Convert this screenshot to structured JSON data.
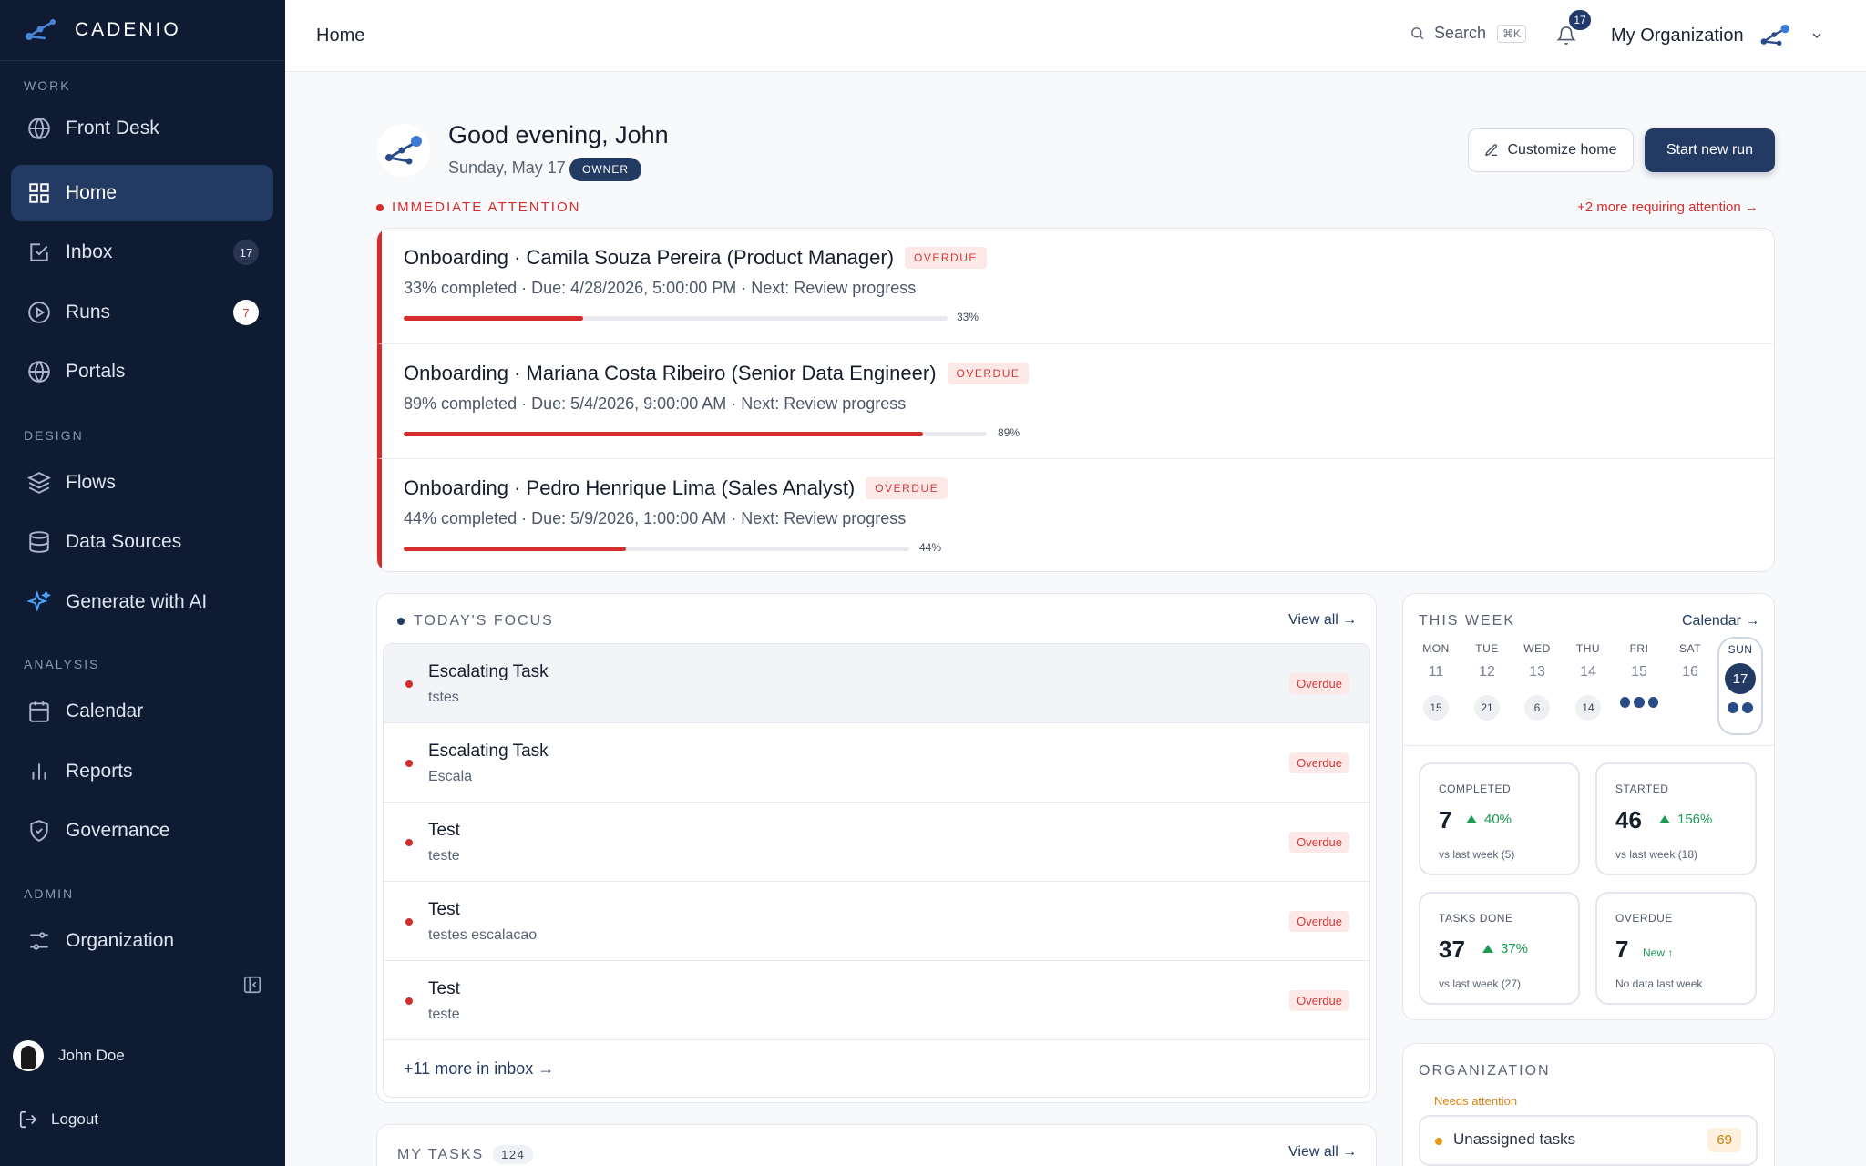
{
  "app": {
    "name": "CADENIO"
  },
  "sidebar": {
    "sections": {
      "work": "WORK",
      "design": "DESIGN",
      "analysis": "ANALYSIS",
      "admin": "ADMIN"
    },
    "items": {
      "front_desk": {
        "label": "Front Desk",
        "icon": "globe-icon"
      },
      "home": {
        "label": "Home",
        "icon": "grid-icon",
        "active": true
      },
      "inbox": {
        "label": "Inbox",
        "icon": "inbox-icon",
        "badge": "17"
      },
      "runs": {
        "label": "Runs",
        "icon": "play-circle-icon",
        "badge": "7"
      },
      "portals": {
        "label": "Portals",
        "icon": "globe-icon"
      },
      "flows": {
        "label": "Flows",
        "icon": "layers-icon"
      },
      "data_sources": {
        "label": "Data Sources",
        "icon": "database-icon"
      },
      "generate_ai": {
        "label": "Generate with AI",
        "icon": "sparkles-icon"
      },
      "calendar": {
        "label": "Calendar",
        "icon": "calendar-icon"
      },
      "reports": {
        "label": "Reports",
        "icon": "bar-chart-icon"
      },
      "governance": {
        "label": "Governance",
        "icon": "shield-icon"
      },
      "organization": {
        "label": "Organization",
        "icon": "sliders-icon"
      }
    },
    "user": {
      "name": "John Doe"
    },
    "logout": "Logout"
  },
  "topbar": {
    "title": "Home",
    "search_label": "Search",
    "search_shortcut": "⌘K",
    "notifications": "17",
    "org_name": "My Organization"
  },
  "greeting": {
    "title": "Good evening, John",
    "date": "Sunday, May 17",
    "role": "OWNER",
    "customize": "Customize home",
    "start_run": "Start new run"
  },
  "attention": {
    "heading": "IMMEDIATE ATTENTION",
    "more": "+2 more requiring attention →",
    "tag": "OVERDUE",
    "items": [
      {
        "title": "Onboarding · Camila Souza Pereira (Product Manager)",
        "detail": "33% completed · Due: 4/28/2026, 5:00:00 PM · Next: Review progress",
        "progress": 0.33,
        "pct_label": "33%"
      },
      {
        "title": "Onboarding · Mariana Costa Ribeiro (Senior Data Engineer)",
        "detail": "89% completed · Due: 5/4/2026, 9:00:00 AM · Next: Review progress",
        "progress": 0.89,
        "pct_label": "89%"
      },
      {
        "title": "Onboarding · Pedro Henrique Lima (Sales Analyst)",
        "detail": "44% completed · Due: 5/9/2026, 1:00:00 AM · Next: Review progress",
        "progress": 0.44,
        "pct_label": "44%"
      }
    ]
  },
  "focus": {
    "heading": "TODAY'S FOCUS",
    "view_all": "View all →",
    "items": [
      {
        "title": "Escalating Task",
        "subtitle": "tstes",
        "status": "Overdue"
      },
      {
        "title": "Escalating Task",
        "subtitle": "Escala",
        "status": "Overdue"
      },
      {
        "title": "Test",
        "subtitle": "teste",
        "status": "Overdue"
      },
      {
        "title": "Test",
        "subtitle": "testes escalacao",
        "status": "Overdue"
      },
      {
        "title": "Test",
        "subtitle": "teste",
        "status": "Overdue"
      }
    ],
    "more": "+11 more in inbox →"
  },
  "tasks": {
    "heading": "MY TASKS",
    "count": "124",
    "view_all": "View all →"
  },
  "week": {
    "heading": "THIS WEEK",
    "calendar_link": "Calendar →",
    "days": [
      {
        "name": "MON",
        "date": "11",
        "count": "15"
      },
      {
        "name": "TUE",
        "date": "12",
        "count": "21"
      },
      {
        "name": "WED",
        "date": "13",
        "count": "6"
      },
      {
        "name": "THU",
        "date": "14",
        "count": "14"
      },
      {
        "name": "FRI",
        "date": "15",
        "dots": 3
      },
      {
        "name": "SAT",
        "date": "16"
      },
      {
        "name": "SUN",
        "date": "17",
        "dots": 2,
        "today": true
      }
    ],
    "stats": {
      "completed": {
        "label": "COMPLETED",
        "value": "7",
        "trend": "40%",
        "compare": "vs last week (5)"
      },
      "started": {
        "label": "STARTED",
        "value": "46",
        "trend": "156%",
        "compare": "vs last week (18)"
      },
      "tasks_done": {
        "label": "TASKS DONE",
        "value": "37",
        "trend": "37%",
        "compare": "vs last week (27)"
      },
      "overdue": {
        "label": "OVERDUE",
        "value": "7",
        "trend": "New ↑",
        "compare": "No data last week"
      }
    }
  },
  "organization": {
    "heading": "ORGANIZATION",
    "needs_attention": "Needs attention",
    "items": [
      {
        "label": "Unassigned tasks",
        "value": "69"
      }
    ]
  },
  "colors": {
    "sidebar_bg": "#0f1b33",
    "primary": "#233a63",
    "danger": "#d62c2c",
    "success": "#1f9a55",
    "warning": "#e69a1a"
  }
}
